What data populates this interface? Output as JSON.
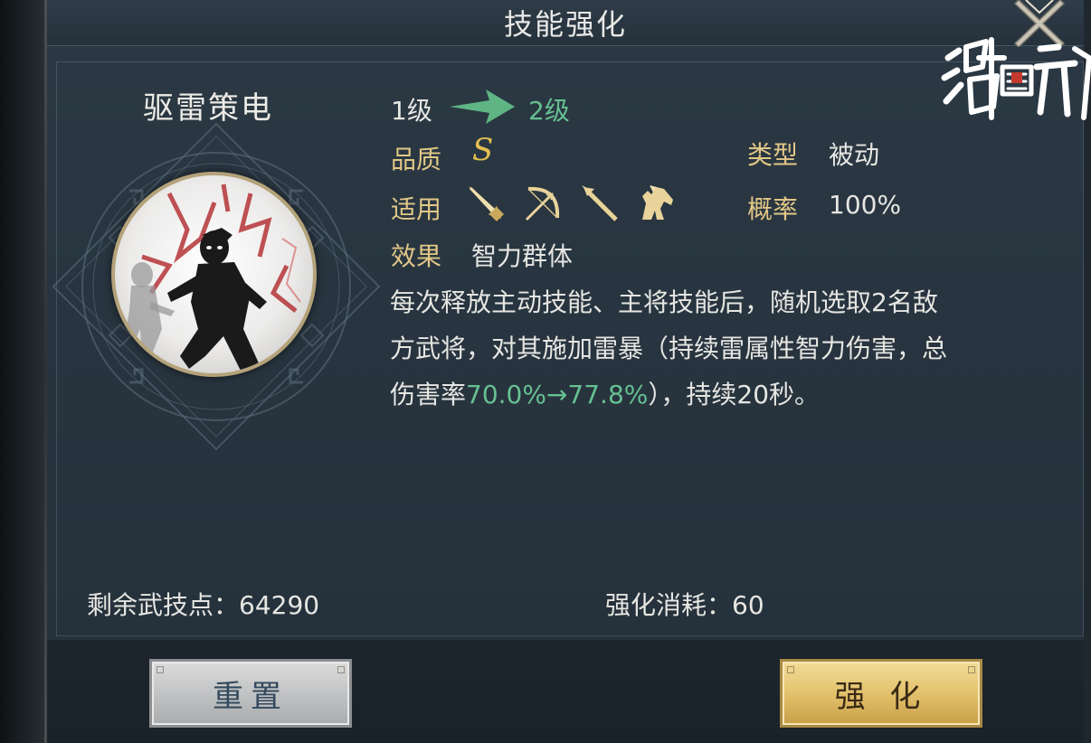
{
  "header": {
    "title": "技能强化"
  },
  "logo": {
    "text": "鸿图之下"
  },
  "skill": {
    "name": "驱雷策电",
    "level_from": "1级",
    "level_to": "2级",
    "quality_label": "品质",
    "quality_value": "S",
    "type_label": "类型",
    "type_value": "被动",
    "apply_label": "适用",
    "apply_icons": [
      "sword-icon",
      "bow-icon",
      "spear-icon",
      "horse-icon"
    ],
    "rate_label": "概率",
    "rate_value": "100%",
    "effect_label": "效果",
    "effect_value": "智力群体",
    "description": {
      "line1": "每次释放主动技能、主将技能后，随机选取2名敌",
      "line2": "方武将，对其施加雷暴（持续雷属性智力伤害，总",
      "line3_prefix": "伤害率",
      "line3_highlight": "70.0%→77.8%",
      "line3_suffix": "），持续20秒。"
    }
  },
  "footer": {
    "remaining_points": "剩余武技点：64290",
    "enhance_cost": "强化消耗：60"
  },
  "buttons": {
    "reset": "重置",
    "enhance": "强 化"
  },
  "colors": {
    "label_gold": "#e2c787",
    "highlight_green": "#66c091",
    "quality_gold": "#e5c04f"
  }
}
